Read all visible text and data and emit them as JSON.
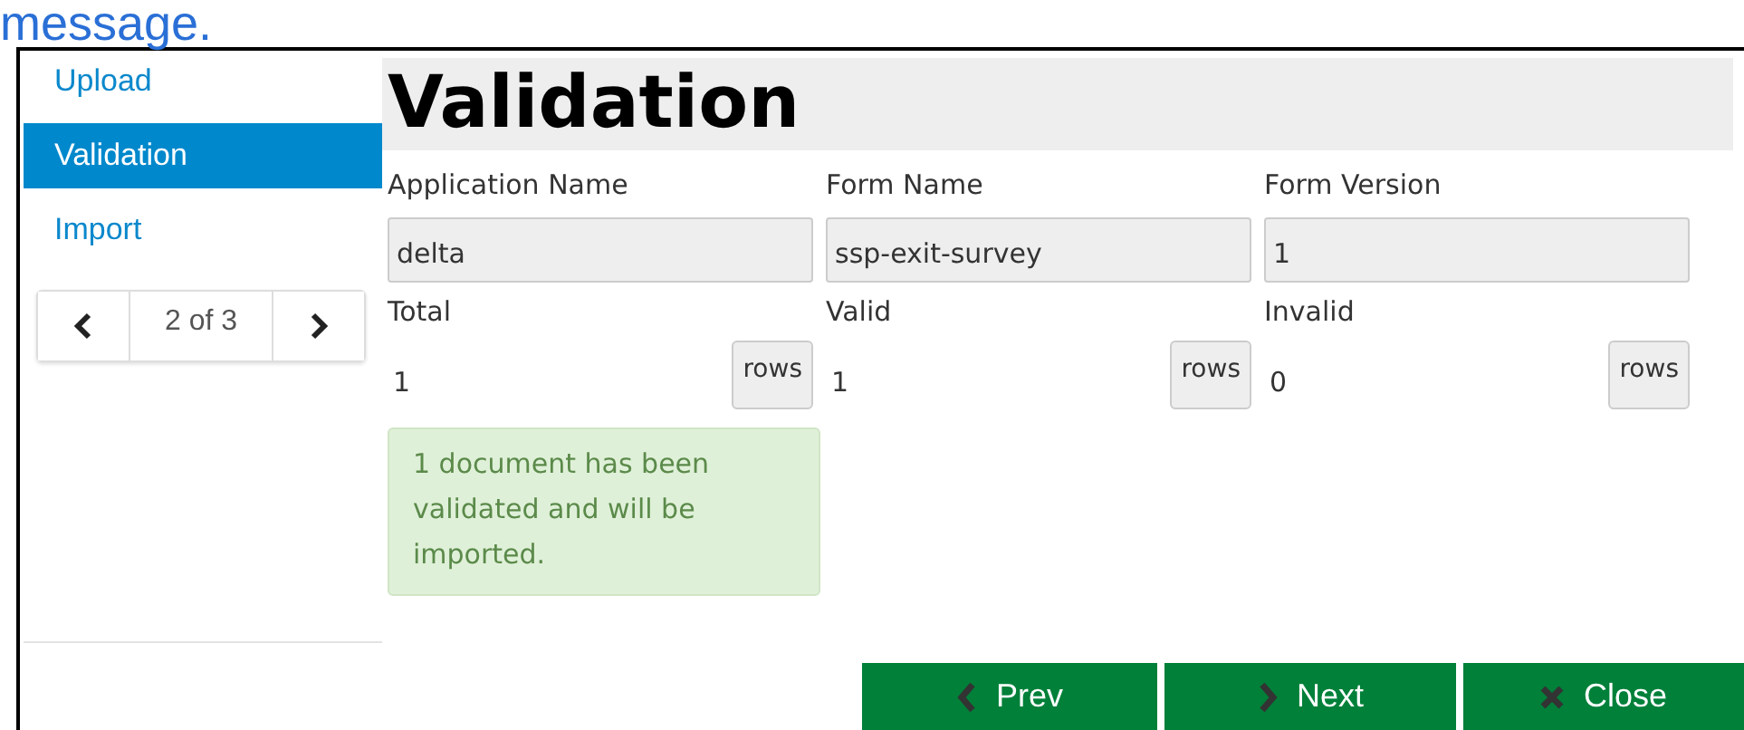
{
  "top_text": "message.",
  "nav": {
    "items": [
      {
        "label": "Upload",
        "selected": false
      },
      {
        "label": "Validation",
        "selected": true
      },
      {
        "label": "Import",
        "selected": false
      }
    ],
    "pager": {
      "text": "2 of 3"
    }
  },
  "heading": "Validation",
  "fields": [
    {
      "label": "Application Name",
      "value": "delta"
    },
    {
      "label": "Form Name",
      "value": "ssp-exit-survey"
    },
    {
      "label": "Form Version",
      "value": "1"
    }
  ],
  "counts": [
    {
      "label": "Total",
      "value": "1",
      "unit": "rows"
    },
    {
      "label": "Valid",
      "value": "1",
      "unit": "rows"
    },
    {
      "label": "Invalid",
      "value": "0",
      "unit": "rows"
    }
  ],
  "alert": "1 document has been validated and will be imported.",
  "buttons": [
    {
      "kind": "prev",
      "label": "Prev"
    },
    {
      "kind": "next",
      "label": "Next"
    },
    {
      "kind": "close",
      "label": "Close"
    }
  ]
}
